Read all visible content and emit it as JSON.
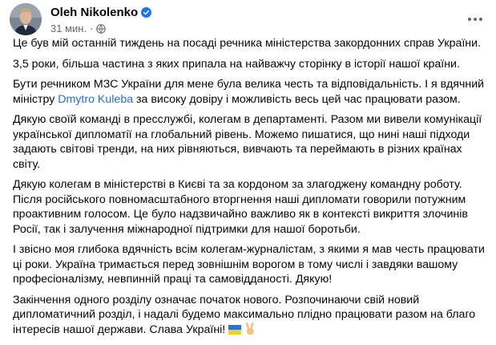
{
  "post": {
    "author": {
      "name": "Oleh Nikolenko",
      "verified_icon": "verified-badge-icon"
    },
    "meta": {
      "time": "31 мин.",
      "separator": "·",
      "audience_icon": "globe-icon"
    },
    "more_icon": "more-options-icon",
    "paragraphs": [
      "Це був мій останній тиждень на посаді речника міністерства закордонних справ України.",
      "3,5 роки, більша частина з яких припала на найважчу сторінку в історії нашої країни.",
      "Дякую своїй команді в пресслужбі, колегам в департаменті. Разом ми вивели комунікації української дипломатії на глобальний рівень. Можемо пишатися, що нині наші підходи задають світові тренди, на них рівняються, вивчають та переймають в різних країнах світу.",
      "Дякую колегам в міністерстві в Києві та за кордоном за злагоджену командну роботу. Після російського повномасштабного вторгнення наші дипломати говорили потужним проактивним голосом. Це було надзвичайно важливо як в контексті викриття злочинів Росії, так і залучення міжнародної підтримки для нашої боротьби.",
      "І звісно моя глибока вдячність всім колегам-журналістам, з якими я мав честь працювати ці роки. Україна тримається перед зовнішнім ворогом в тому числі і завдяки вашому професіоналізму, невпинній праці та самовідданості. Дякую!"
    ],
    "p3": {
      "before": "Бути речником МЗС України для мене була велика честь та відповідальність. І я вдячний міністру ",
      "mention": "Dmytro Kuleba",
      "after": " за високу довіру і можливість весь цей час працювати разом."
    },
    "last": {
      "text": "Закінчення одного розділу означає початок нового. Розпочинаючи свій новий дипломатичний розділ, і надалі будемо максимально плідно працювати разом на благо інтересів нашої держави. Слава Україні!",
      "emojis": [
        "ukraine-flag-icon",
        "victory-hand-icon"
      ]
    },
    "colors": {
      "link": "#216fdb",
      "meta": "#65676b",
      "verified": "#1877f2"
    }
  }
}
